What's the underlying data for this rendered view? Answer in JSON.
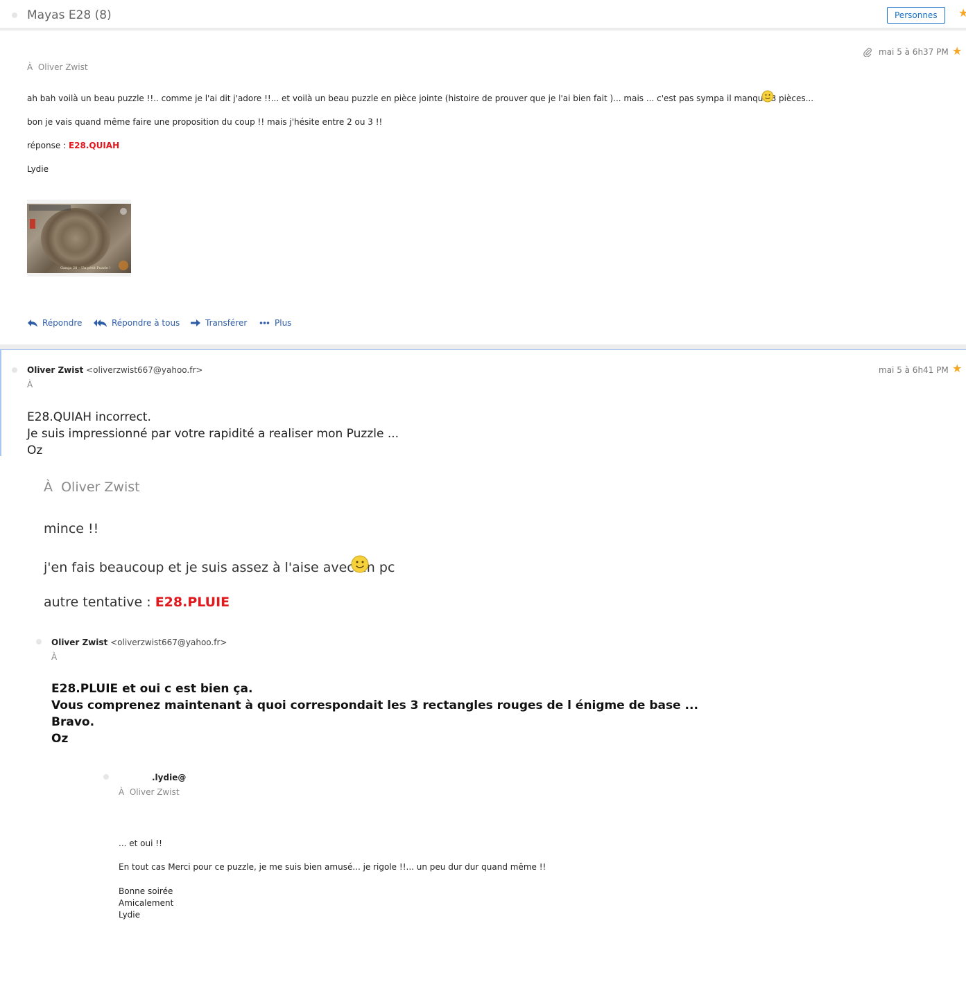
{
  "thread": {
    "title": "Mayas E28 (8)",
    "people_button": "Personnes"
  },
  "message1": {
    "date": "mai 5 à 6h37 PM",
    "to_prefix": "À",
    "to_name": "Oliver Zwist",
    "line1": "ah bah voilà un beau puzzle !!.. comme je l'ai dit j'adore !!... et voilà un beau puzzle en pièce jointe (histoire de prouver que je l'ai bien fait )... mais ... c'est pas sympa il manque 3 pièces...",
    "line2": "bon je vais quand même faire une proposition du coup !! mais j'hésite entre 2 ou 3 !!",
    "answer_label": "réponse : ",
    "answer_value": "E28.QUIAH",
    "signature": "Lydie",
    "attachment_caption": "Ganga 28 – Un petit Puzzle !",
    "actions": {
      "reply": "Répondre",
      "reply_all": "Répondre à tous",
      "forward": "Transférer",
      "more": "Plus"
    }
  },
  "message2": {
    "sender_name": "Oliver Zwist",
    "sender_email": "<oliverzwist667@yahoo.fr>",
    "to_prefix": "À",
    "date": "mai 5 à 6h41 PM",
    "line1": "E28.QUIAH incorrect.",
    "line2": "Je suis impressionné par votre rapidité a realiser mon Puzzle ...",
    "line3": "Oz"
  },
  "quoted_lydie": {
    "to_prefix": "À",
    "to_name": "Oliver Zwist",
    "line1": "mince !!",
    "line2": "j'en fais beaucoup et je suis assez à l'aise avec un pc",
    "attempt_label": "autre tentative : ",
    "attempt_value": "E28.PLUIE"
  },
  "quoted_oz": {
    "sender_name": "Oliver Zwist",
    "sender_email": "<oliverzwist667@yahoo.fr>",
    "to_prefix": "À",
    "line1": "E28.PLUIE et oui c est bien ça.",
    "line2": "Vous comprenez maintenant à quoi correspondait les 3 rectangles rouges de l énigme de base ...",
    "line3": "Bravo.",
    "line4": "Oz"
  },
  "quoted_lydie2": {
    "sender": ".lydie@",
    "to_prefix": "À",
    "to_name": "Oliver Zwist",
    "line1": "... et oui !!",
    "line2": "En tout cas Merci pour ce puzzle, je me suis bien amusé... je rigole !!... un peu dur dur quand même !!",
    "line3": "Bonne soirée",
    "line4": "Amicalement",
    "line5": "Lydie"
  },
  "colors": {
    "accent": "#1a73c8",
    "star": "#f5a623",
    "answer_red": "#e0191e",
    "action_blue": "#2f5ea8"
  }
}
